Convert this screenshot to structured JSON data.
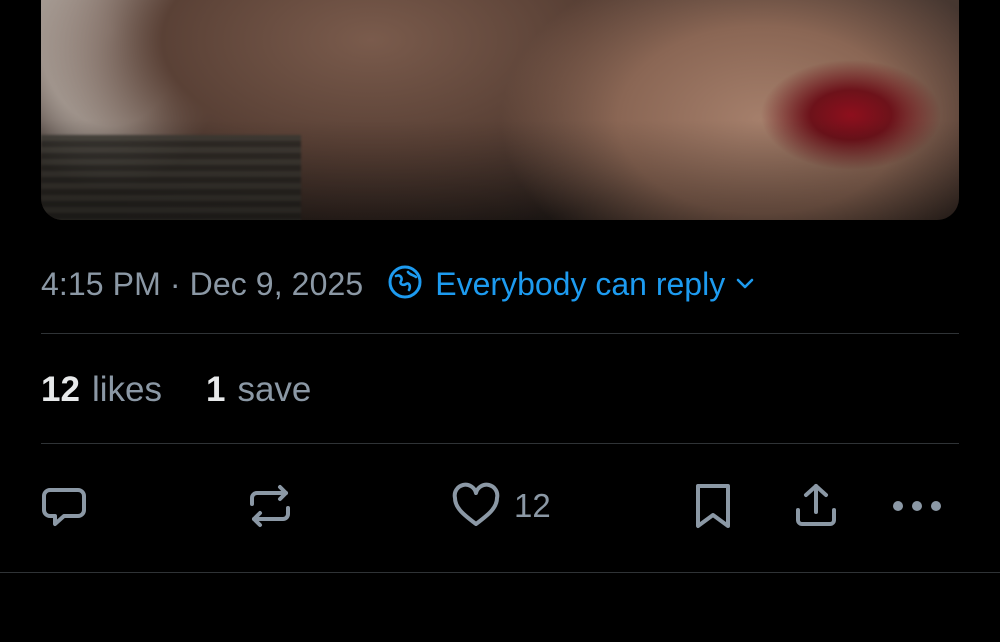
{
  "post": {
    "timestamp": "4:15 PM · Dec 9, 2025",
    "audience": {
      "label": "Everybody can reply",
      "icon": "globe-icon",
      "chevron_icon": "chevron-down-icon",
      "color": "#1d9bf0"
    }
  },
  "stats": {
    "likes_count": "12",
    "likes_label": "likes",
    "saves_count": "1",
    "saves_label": "save"
  },
  "actions": {
    "reply_icon": "reply-icon",
    "repost_icon": "repost-icon",
    "like_icon": "heart-icon",
    "like_count": "12",
    "bookmark_icon": "bookmark-icon",
    "share_icon": "share-icon",
    "more_icon": "more-icon"
  },
  "colors": {
    "background": "#000000",
    "muted_text": "#8b98a5",
    "primary_text": "#e7e9ea",
    "accent": "#1d9bf0",
    "divider": "#2f3336"
  }
}
